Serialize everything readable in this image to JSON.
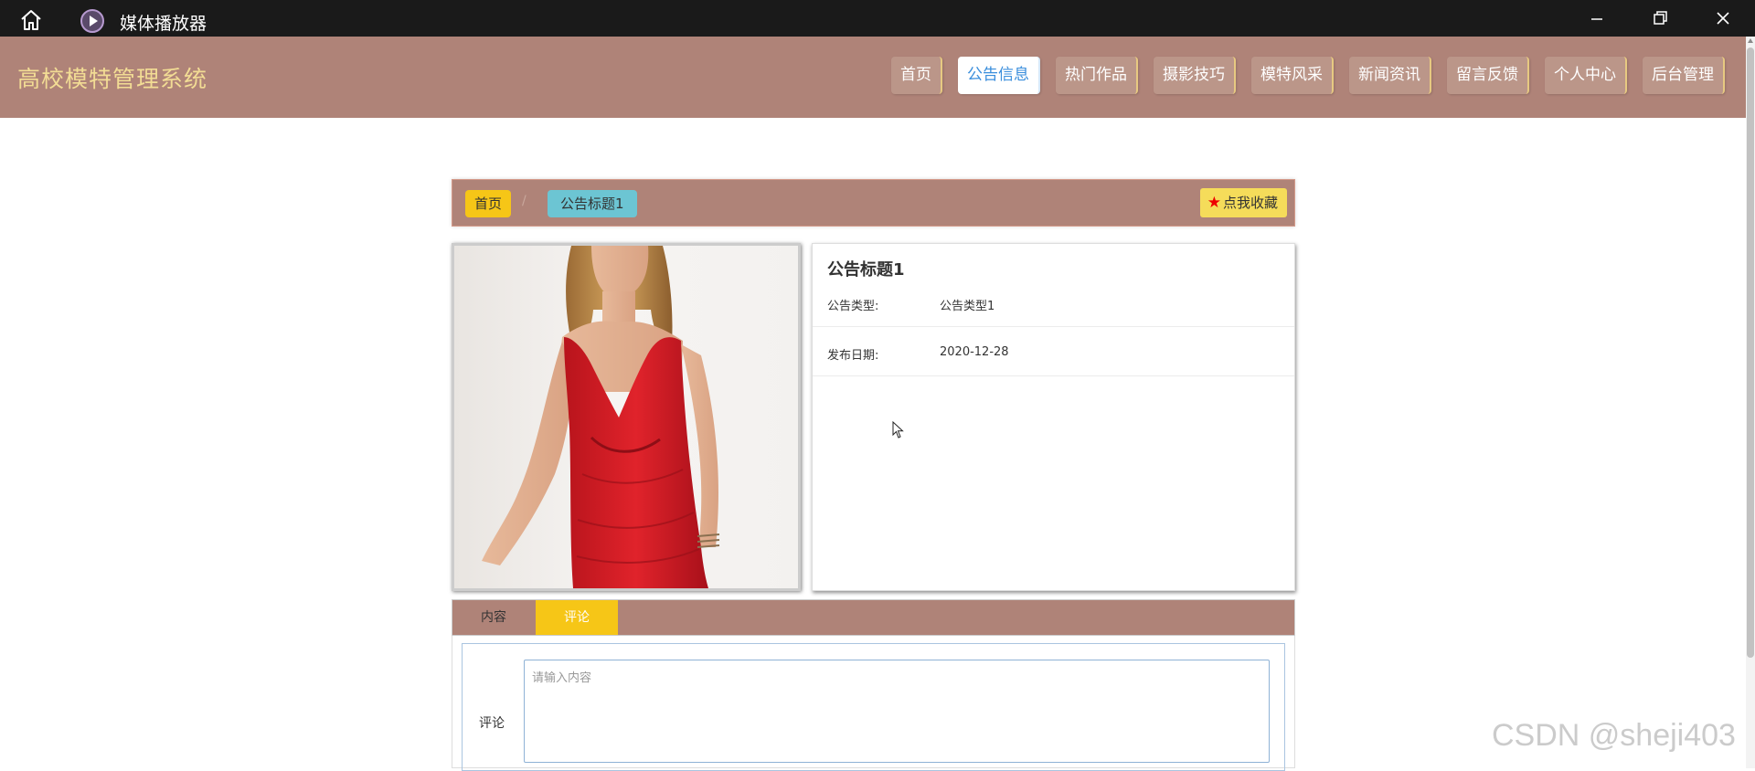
{
  "window": {
    "title": "媒体播放器"
  },
  "header": {
    "brand": "高校模特管理系统",
    "nav": [
      "首页",
      "公告信息",
      "热门作品",
      "摄影技巧",
      "模特风采",
      "新闻资讯",
      "留言反馈",
      "个人中心",
      "后台管理"
    ],
    "active_index": 1
  },
  "breadcrumb": {
    "home": "首页",
    "separator": "/",
    "current": "公告标题1"
  },
  "favorite": {
    "label": "点我收藏"
  },
  "detail": {
    "title": "公告标题1",
    "fields": [
      {
        "key": "公告类型:",
        "value": "公告类型1"
      },
      {
        "key": "发布日期:",
        "value": "2020-12-28"
      }
    ]
  },
  "tabs": [
    "内容",
    "评论"
  ],
  "comment": {
    "label": "评论",
    "placeholder": "请输入内容"
  },
  "watermark": "CSDN @sheji403",
  "colors": {
    "header_bg": "#af8378",
    "brand": "#f2dc94",
    "active_tab": "#f6c617",
    "crumb_current": "#6cc5d3"
  }
}
